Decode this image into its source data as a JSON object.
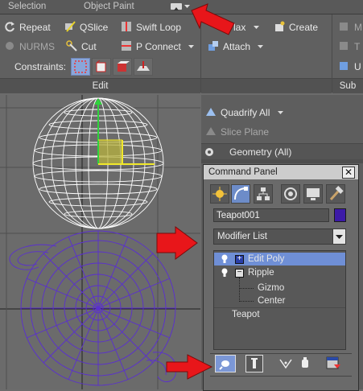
{
  "tabs": {
    "selection": "Selection",
    "object_paint": "Object Paint"
  },
  "ribbon": {
    "repeat": "Repeat",
    "qslice": "QSlice",
    "swift_loop": "Swift Loop",
    "nurms": "NURMS",
    "cut": "Cut",
    "p_connect": "P Connect",
    "constraints": "Constraints:",
    "edit_group": "Edit",
    "relax": "lax",
    "create": "Create",
    "attach": "Attach",
    "partial_m": "M",
    "partial_t": "T",
    "partial_u": "U",
    "sub_group": "Sub",
    "quadrify_all": "Quadrify All",
    "slice_plane": "Slice Plane",
    "geometry_all": "Geometry (All)"
  },
  "command_panel": {
    "title": "Command Panel",
    "object_name": "Teapot001",
    "modifier_list": "Modifier List",
    "stack": {
      "edit_poly": "Edit Poly",
      "ripple": "Ripple",
      "gizmo": "Gizmo",
      "center": "Center",
      "teapot": "Teapot"
    }
  },
  "colors": {
    "object_color": "#3c1aa8",
    "arrow_red": "#e8161a",
    "selected_row": "#6f8fd6",
    "wire_white": "#ffffff",
    "wire_purple": "#5a2fd0"
  }
}
